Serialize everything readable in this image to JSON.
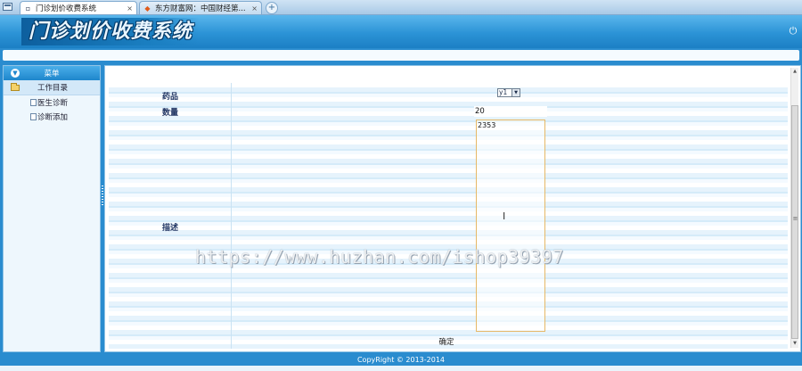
{
  "browser": {
    "tabs": [
      {
        "label": "门诊划价收费系统",
        "close": "×"
      },
      {
        "label": "东方财富网：中国财经第...",
        "close": "×"
      }
    ],
    "new_tab": "+"
  },
  "header": {
    "logo_text": "门诊划价收费系统",
    "power_icon": "⏻"
  },
  "sidebar": {
    "menu_title": "菜单",
    "folder_label": "工作目录",
    "items": [
      {
        "label": "医生诊断"
      },
      {
        "label": "诊断添加"
      }
    ]
  },
  "form": {
    "drug_label": "药品",
    "drug_selected": "y1",
    "quantity_label": "数量",
    "quantity_value": "20",
    "description_label": "描述",
    "description_value": "2353",
    "confirm_label": "确定"
  },
  "footer": {
    "copyright": "CopyRight © 2013-2014"
  },
  "watermark": "https://www.huzhan.com/ishop39397",
  "colors": {
    "primary": "#2a8ccf",
    "header_light": "#5ab6ec",
    "textarea_border": "#e6b866"
  }
}
